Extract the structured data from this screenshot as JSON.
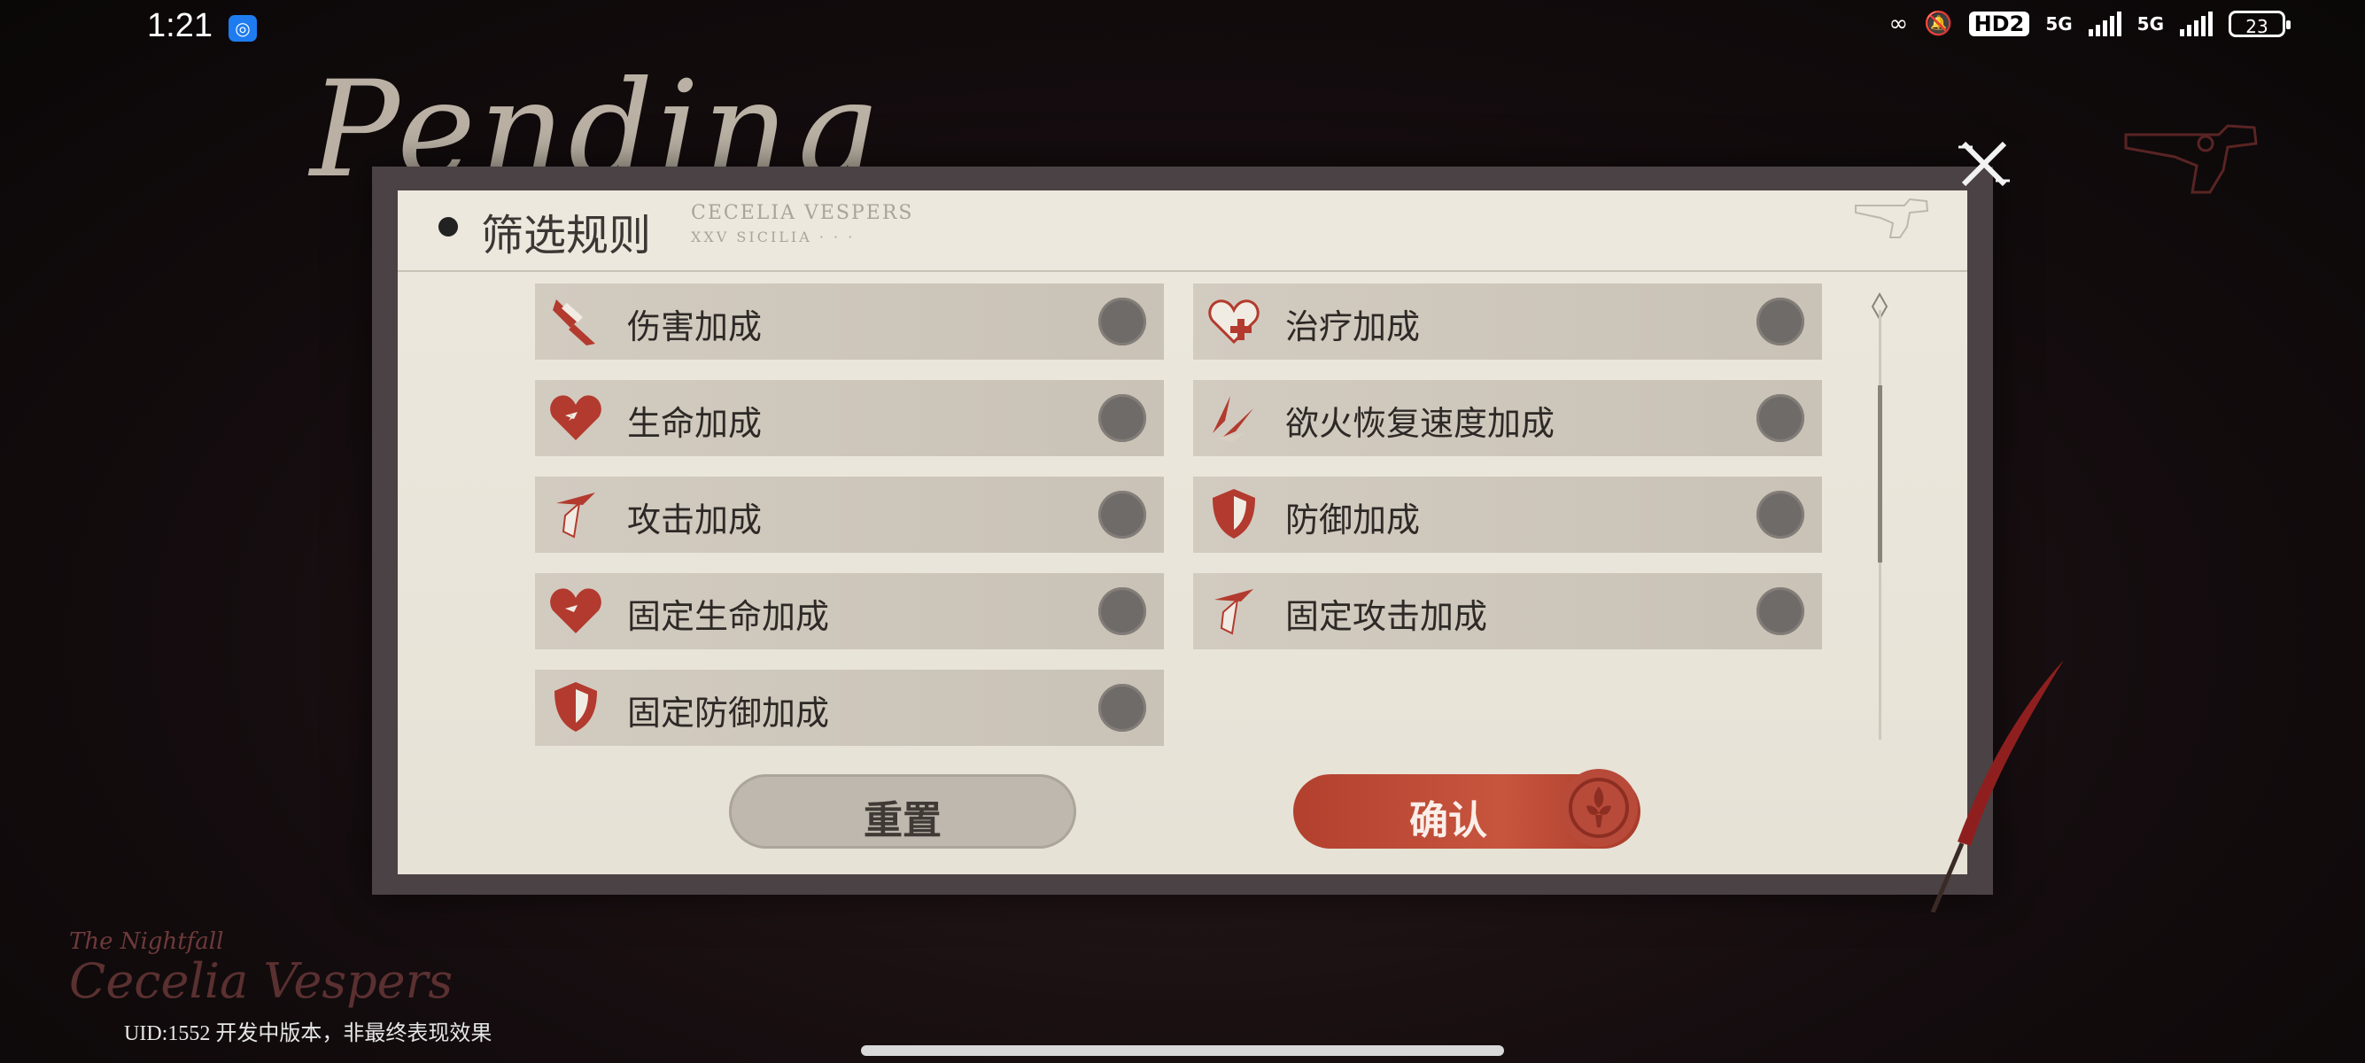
{
  "status_bar": {
    "time": "1:21",
    "hd_label": "HD2",
    "network_1": "5G",
    "network_2": "5G",
    "battery": "23"
  },
  "background": {
    "script_text": "Pending",
    "nightfall_text": "The Nightfall",
    "logo_text": "Cecelia Vespers"
  },
  "modal": {
    "title": "筛选规则",
    "header_faint": "CECELIA VESPERS",
    "header_faint_sub": "XXV SICILIA · · ·",
    "options": [
      {
        "label": "伤害加成",
        "icon": "damage-icon",
        "selected": false
      },
      {
        "label": "治疗加成",
        "icon": "heal-icon",
        "selected": false
      },
      {
        "label": "生命加成",
        "icon": "heart-icon",
        "selected": false
      },
      {
        "label": "欲火恢复速度加成",
        "icon": "flame-claw-icon",
        "selected": false
      },
      {
        "label": "攻击加成",
        "icon": "attack-icon",
        "selected": false
      },
      {
        "label": "防御加成",
        "icon": "shield-icon",
        "selected": false
      },
      {
        "label": "固定生命加成",
        "icon": "heart-icon",
        "selected": false
      },
      {
        "label": "固定攻击加成",
        "icon": "attack-icon",
        "selected": false
      },
      {
        "label": "固定防御加成",
        "icon": "shield-icon",
        "selected": false
      }
    ],
    "reset_label": "重置",
    "confirm_label": "确认"
  },
  "footer": {
    "uid_text": "UID:1552   开发中版本，非最终表现效果"
  },
  "colors": {
    "accent_red": "#b2402e",
    "paper": "#ece8de",
    "toggle_off": "#6f6b68"
  }
}
